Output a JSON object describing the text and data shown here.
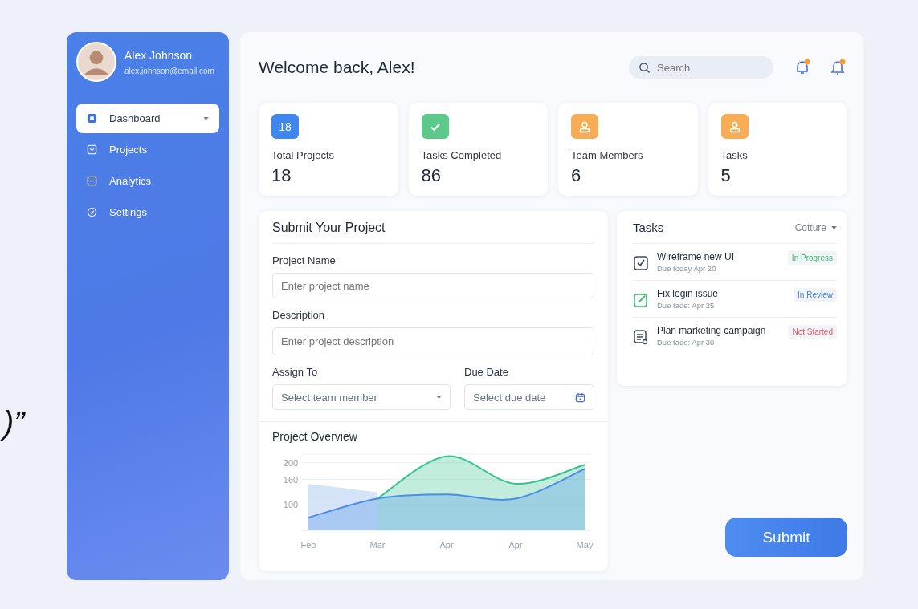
{
  "edge_fragment": ")”",
  "sidebar": {
    "user": {
      "name": "Alex Johnson",
      "email": "alex.johnson@email.com"
    },
    "items": [
      {
        "label": "Dashboard",
        "kind": "square",
        "selected": true,
        "dropdown": true
      },
      {
        "label": "Projects",
        "kind": "tray",
        "selected": false,
        "dropdown": false
      },
      {
        "label": "Analytics",
        "kind": "panel",
        "selected": false,
        "dropdown": false
      },
      {
        "label": "Settings",
        "kind": "gauge",
        "selected": false,
        "dropdown": false
      }
    ]
  },
  "header": {
    "title": "Welcome back, Alex!",
    "search": {
      "placeholder": "Search"
    }
  },
  "stats": [
    {
      "kind": "number",
      "icon_text": "18",
      "color": "#3f86ee",
      "label": "Total Projects",
      "value": "18"
    },
    {
      "kind": "check",
      "color": "#5cc98a",
      "label": "Tasks Completed",
      "value": "86"
    },
    {
      "kind": "person",
      "color": "#f7ad55",
      "label": "Team Members",
      "value": "6"
    },
    {
      "kind": "person",
      "color": "#f7ad55",
      "label": "Tasks",
      "value": "5"
    }
  ],
  "form": {
    "title": "Submit Your Project",
    "project_name": {
      "label": "Project Name",
      "placeholder": "Enter project name"
    },
    "description": {
      "label": "Description",
      "placeholder": "Enter project description"
    },
    "assign_to": {
      "label": "Assign To",
      "placeholder": "Select team member"
    },
    "due_date": {
      "label": "Due Date",
      "placeholder": "Select due date"
    }
  },
  "overview": {
    "title": "Project Overview",
    "chart_data": {
      "type": "area",
      "categories": [
        "Feb",
        "Mar",
        "Apr",
        "Apr",
        "May"
      ],
      "ylim": [
        40,
        220
      ],
      "yticks": [
        100,
        160,
        200
      ],
      "grid": true,
      "series": [
        {
          "color": "#c9dcf5",
          "values": [
            150,
            130,
            null,
            null,
            null
          ]
        },
        {
          "color": "#35c48f",
          "values": [
            null,
            115,
            215,
            150,
            195
          ]
        },
        {
          "color": "#4a8ee8",
          "values": [
            70,
            115,
            125,
            115,
            185
          ]
        }
      ]
    }
  },
  "tasks": {
    "title": "Tasks",
    "filter": "Cotture",
    "items": [
      {
        "kind": "checkbox",
        "title": "Wireframe new UI",
        "due": "Due today Apr 20",
        "status": "In Progress",
        "color": "#3dba6a"
      },
      {
        "kind": "edit",
        "title": "Fix login issue",
        "due": "Due tade: Apr 25",
        "status": "In Review",
        "color": "#3d7fe0"
      },
      {
        "kind": "document",
        "title": "Plan marketing campaign",
        "due": "Due tade: Apr 30",
        "status": "Not Started",
        "color": "#e05a5a"
      }
    ]
  },
  "submit_button": "Submit"
}
